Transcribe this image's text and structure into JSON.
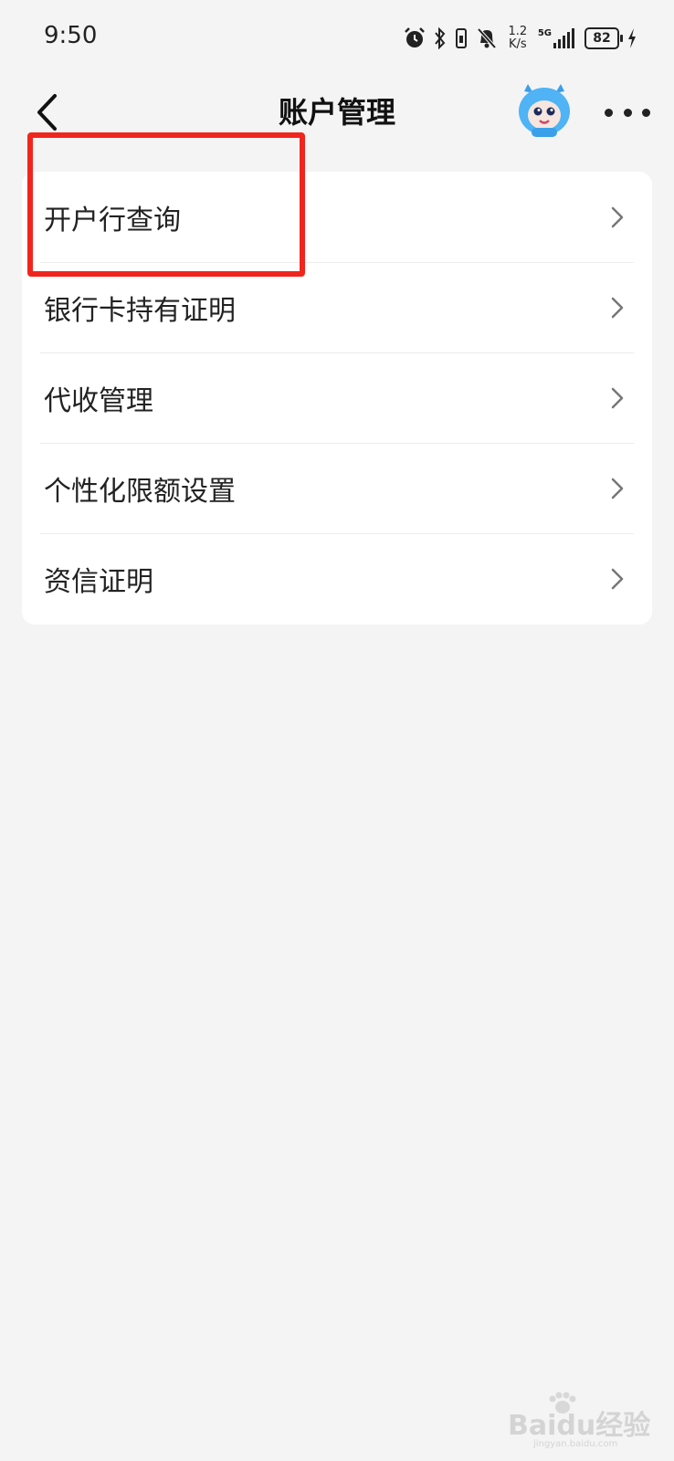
{
  "status_bar": {
    "time": "9:50",
    "net_speed_value": "1.2",
    "net_speed_unit": "K/s",
    "signal_label": "5G",
    "battery": "82",
    "icons": [
      "alarm-icon",
      "bluetooth-icon",
      "vibrate-icon",
      "mute-bell-icon",
      "signal-icon",
      "battery-icon",
      "charging-icon"
    ]
  },
  "header": {
    "title": "账户管理"
  },
  "menu": {
    "items": [
      {
        "label": "开户行查询"
      },
      {
        "label": "银行卡持有证明"
      },
      {
        "label": "代收管理"
      },
      {
        "label": "个性化限额设置"
      },
      {
        "label": "资信证明"
      }
    ]
  },
  "annotation": {
    "highlight_color": "#f0261e"
  },
  "watermark": {
    "logo": "Baidu经验",
    "url": "jingyan.baidu.com"
  }
}
